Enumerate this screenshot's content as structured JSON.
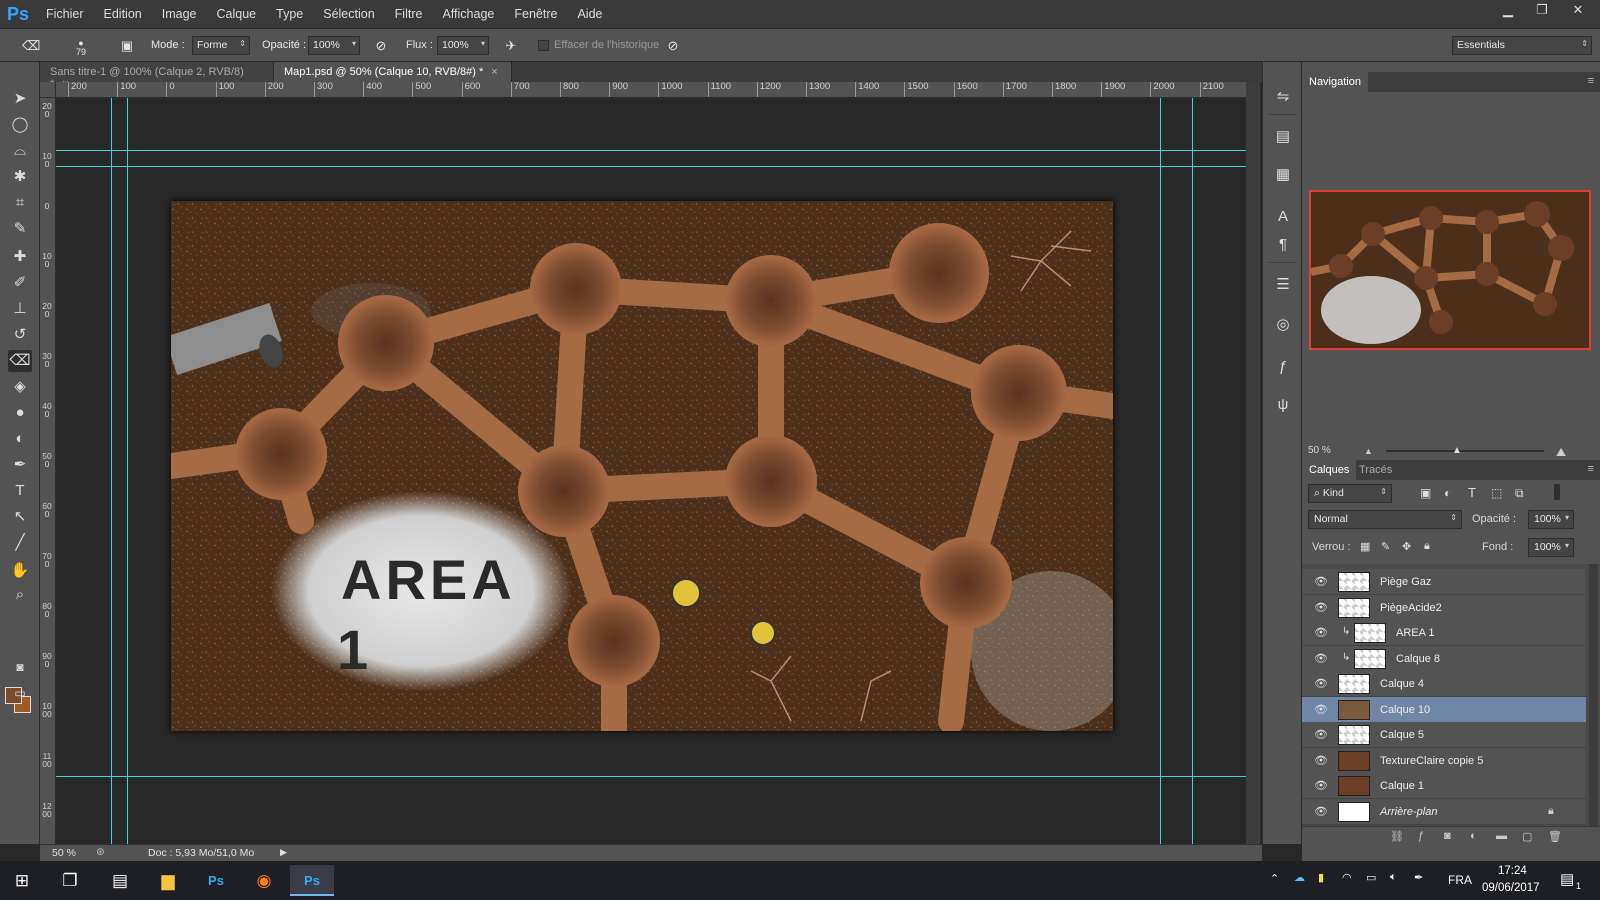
{
  "app": {
    "logo": "Ps",
    "menu": [
      "Fichier",
      "Edition",
      "Image",
      "Calque",
      "Type",
      "Sélection",
      "Filtre",
      "Affichage",
      "Fenêtre",
      "Aide"
    ],
    "window_controls": [
      "minimize-icon",
      "restore-icon",
      "close-icon"
    ]
  },
  "options_bar": {
    "brush_size": "79",
    "mode_label": "Mode :",
    "mode_value": "Forme",
    "opacity_label": "Opacité :",
    "opacity_value": "100%",
    "flow_label": "Flux :",
    "flow_value": "100%",
    "erase_history_label": "Effacer de l'historique",
    "workspace": "Essentials"
  },
  "tabs": [
    {
      "label": "Sans titre-1 @ 100% (Calque 2, RVB/8) *",
      "active": false
    },
    {
      "label": "Map1.psd @ 50% (Calque 10, RVB/8#) *",
      "active": true
    }
  ],
  "ruler_top": [
    "200",
    "100",
    "0",
    "100",
    "200",
    "300",
    "400",
    "500",
    "600",
    "700",
    "800",
    "900",
    "1000",
    "1100",
    "1200",
    "1300",
    "1400",
    "1500",
    "1600",
    "1700",
    "1800",
    "1900",
    "2000",
    "2100"
  ],
  "ruler_left": [
    "200",
    "100",
    "0",
    "100",
    "200",
    "300",
    "400",
    "500",
    "600",
    "700",
    "800",
    "900",
    "1000",
    "1100",
    "1200"
  ],
  "canvas": {
    "area_text": "AREA",
    "area_number": "1"
  },
  "status": {
    "zoom": "50 %",
    "doc": "Doc : 5,93 Mo/51,0 Mo"
  },
  "navigation": {
    "title": "Navigation",
    "zoom": "50 %"
  },
  "layers_panel": {
    "tab_layers": "Calques",
    "tab_paths": "Tracés",
    "filter": "Kind",
    "blend_mode": "Normal",
    "opacity_label": "Opacité :",
    "opacity_value": "100%",
    "lock_label": "Verrou :",
    "fill_label": "Fond :",
    "fill_value": "100%",
    "layers": [
      {
        "name": "Piège Gaz",
        "selected": false,
        "clipped": false,
        "thumb": "transparent"
      },
      {
        "name": "PiègeAcide2",
        "selected": false,
        "clipped": false,
        "thumb": "transparent"
      },
      {
        "name": "AREA          1",
        "selected": false,
        "clipped": true,
        "thumb": "transparent"
      },
      {
        "name": "Calque 8",
        "selected": false,
        "clipped": true,
        "thumb": "transparent"
      },
      {
        "name": "Calque 4",
        "selected": false,
        "clipped": false,
        "thumb": "transparent"
      },
      {
        "name": "Calque 10",
        "selected": true,
        "clipped": false,
        "thumb": "map"
      },
      {
        "name": "Calque 5",
        "selected": false,
        "clipped": false,
        "thumb": "transparent"
      },
      {
        "name": "TextureClaire copie 5",
        "selected": false,
        "clipped": false,
        "thumb": "brown"
      },
      {
        "name": "Calque 1",
        "selected": false,
        "clipped": false,
        "thumb": "brown"
      },
      {
        "name": "Arrière-plan",
        "selected": false,
        "clipped": false,
        "thumb": "white"
      }
    ]
  },
  "taskbar": {
    "lang": "FRA",
    "time": "17:24",
    "date": "09/06/2017",
    "notif_count": "1"
  },
  "colors": {
    "guide": "#3fd6d6",
    "selection": "#6f86a6",
    "nav_frame": "#e23b3b",
    "foreground": "#7a4a2a",
    "background": "#a05a25"
  }
}
